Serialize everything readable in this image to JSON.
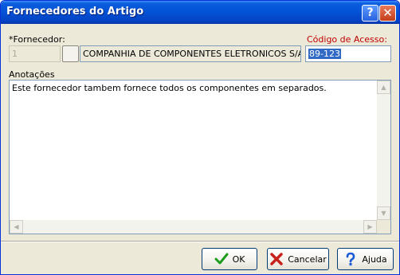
{
  "window": {
    "title": "Fornecedores do Artigo",
    "help_glyph": "?",
    "close_glyph": "✕"
  },
  "form": {
    "supplier_label": "*Fornecedor:",
    "supplier_code": "1",
    "supplier_name": "COMPANHIA DE COMPONENTES ELETRONICOS S/A",
    "access_code_label": "Código de Acesso:",
    "access_code_value": "89-123",
    "notes_label": "Anotações",
    "notes_text": "Este fornecedor tambem fornece todos os componentes em separados."
  },
  "buttons": {
    "ok_label": "OK",
    "cancel_label": "Cancelar",
    "help_label": "Ajuda"
  },
  "icons": {
    "ok": "check-icon",
    "cancel": "x-icon",
    "help": "question-icon"
  },
  "colors": {
    "titlebar": "#0452d6",
    "access_label": "#c00000",
    "selection": "#316ac5",
    "ok_icon": "#1e9c1e",
    "cancel_icon": "#c8201a",
    "help_icon": "#1a5cd6"
  }
}
